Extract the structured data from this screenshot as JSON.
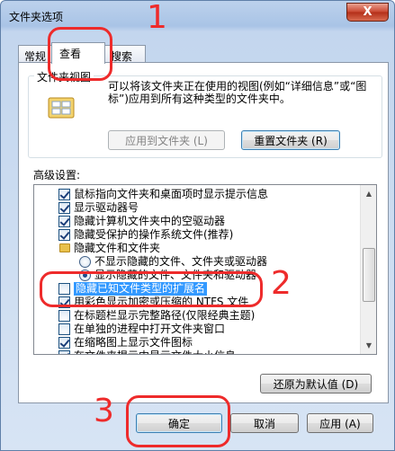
{
  "window": {
    "title": "文件夹选项",
    "close_label": "X"
  },
  "tabs": [
    {
      "label": "常规"
    },
    {
      "label": "查看"
    },
    {
      "label": "搜索"
    }
  ],
  "folder_views": {
    "legend": "文件夹视图",
    "description": "可以将该文件夹正在使用的视图(例如“详细信息”或“图标”)应用到所有这种类型的文件夹中。",
    "apply_button": "应用到文件夹 (L)",
    "reset_button": "重置文件夹 (R)"
  },
  "advanced": {
    "label": "高级设置:",
    "items": [
      {
        "kind": "checkbox",
        "checked": true,
        "label": "鼠标指向文件夹和桌面项时显示提示信息"
      },
      {
        "kind": "checkbox",
        "checked": true,
        "label": "显示驱动器号"
      },
      {
        "kind": "checkbox",
        "checked": true,
        "label": "隐藏计算机文件夹中的空驱动器"
      },
      {
        "kind": "checkbox",
        "checked": true,
        "label": "隐藏受保护的操作系统文件(推荐)"
      },
      {
        "kind": "folder",
        "label": "隐藏文件和文件夹"
      },
      {
        "kind": "radio",
        "checked": false,
        "label": "不显示隐藏的文件、文件夹或驱动器"
      },
      {
        "kind": "radio",
        "checked": true,
        "label": "显示隐藏的文件、文件夹和驱动器"
      },
      {
        "kind": "checkbox",
        "checked": false,
        "selected": true,
        "label": "隐藏已知文件类型的扩展名"
      },
      {
        "kind": "checkbox",
        "checked": true,
        "label": "用彩色显示加密或压缩的 NTFS 文件"
      },
      {
        "kind": "checkbox",
        "checked": false,
        "label": "在标题栏显示完整路径(仅限经典主题)"
      },
      {
        "kind": "checkbox",
        "checked": false,
        "label": "在单独的进程中打开文件夹窗口"
      },
      {
        "kind": "checkbox",
        "checked": true,
        "label": "在缩略图上显示文件图标"
      },
      {
        "kind": "checkbox",
        "checked": true,
        "label": "在文件夹提示中显示文件大小信息"
      }
    ],
    "restore_button": "还原为默认值 (D)"
  },
  "footer": {
    "ok_button": "确定",
    "cancel_button": "取消",
    "apply_button": "应用 (A)"
  },
  "annotations": {
    "step1": "1",
    "step2": "2",
    "step3": "3",
    "color": "#ee2b2b"
  },
  "colors": {
    "selection": "#3399ff",
    "close_button": "#c9452f"
  }
}
